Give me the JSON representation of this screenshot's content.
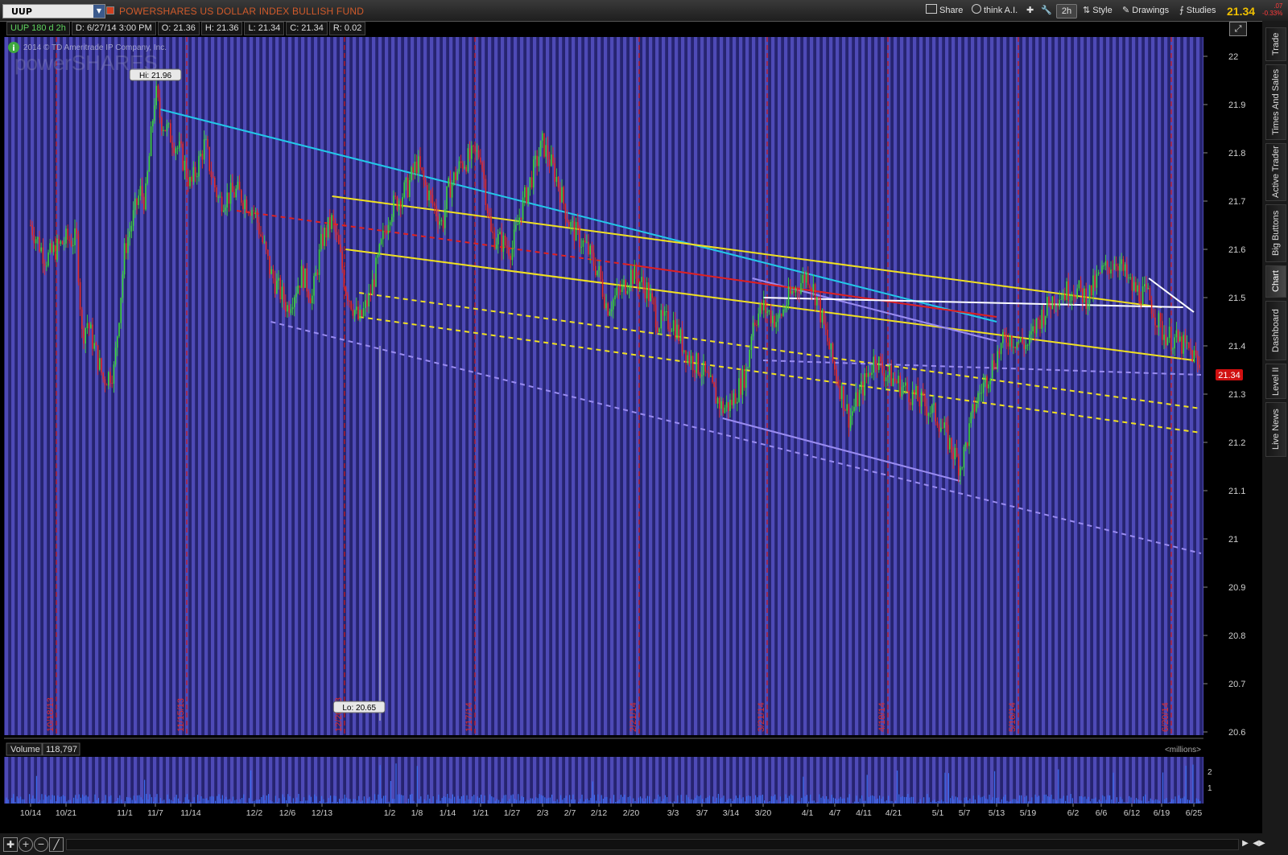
{
  "toolbar": {
    "symbol": "UUP",
    "fund_name": "POWERSHARES US DOLLAR INDEX BULLISH FUND",
    "share": "Share",
    "think": "think A.I.",
    "timeframe": "2h",
    "style": "Style",
    "drawings": "Drawings",
    "studies": "Studies",
    "last_price": "21.34",
    "net_change": ".07",
    "pct_change": "-0.33%"
  },
  "infobar": {
    "chart_spec": "UUP 180 d 2h",
    "date": "D: 6/27/14 3:00 PM",
    "open": "O: 21.36",
    "high": "H: 21.36",
    "low": "L: 21.34",
    "close": "C: 21.34",
    "range": "R: 0.02"
  },
  "watermark": {
    "copyright": "2014 © TD Ameritrade IP Company, Inc.",
    "brand": "powerSHARES"
  },
  "chart_data": {
    "type": "candlestick",
    "symbol": "UUP",
    "ylim": [
      20.6,
      22.05
    ],
    "y_ticks": [
      "22",
      "21.9",
      "21.8",
      "21.7",
      "21.6",
      "21.5",
      "21.4",
      "21.3",
      "21.2",
      "21.1",
      "21",
      "20.9",
      "20.8",
      "20.7",
      "20.6"
    ],
    "x_ticks": [
      "10/14",
      "10/21",
      "11/1",
      "11/7",
      "11/14",
      "12/2",
      "12/6",
      "12/13",
      "1/2",
      "1/8",
      "1/14",
      "1/21",
      "1/27",
      "2/3",
      "2/7",
      "2/12",
      "2/20",
      "3/3",
      "3/7",
      "3/14",
      "3/20",
      "4/1",
      "4/7",
      "4/11",
      "4/21",
      "5/1",
      "5/7",
      "5/13",
      "5/19",
      "6/2",
      "6/6",
      "6/12",
      "6/19",
      "6/25"
    ],
    "expiration_labels": [
      "10/18/13",
      "11/15/13",
      "12/20/13",
      "1/17/14",
      "2/21/14",
      "3/21/14",
      "4/18/14",
      "5/16/14",
      "6/20/14"
    ],
    "grid": false,
    "price_series": [
      {
        "x": "10/14",
        "y": 21.65
      },
      {
        "x": "10/17",
        "y": 21.58
      },
      {
        "x": "10/21",
        "y": 21.62
      },
      {
        "x": "10/23",
        "y": 21.62
      },
      {
        "x": "10/24",
        "y": 21.42
      },
      {
        "x": "10/25",
        "y": 21.45
      },
      {
        "x": "10/28",
        "y": 21.33
      },
      {
        "x": "10/30",
        "y": 21.35
      },
      {
        "x": "11/1",
        "y": 21.6
      },
      {
        "x": "11/4",
        "y": 21.72
      },
      {
        "x": "11/5",
        "y": 21.7
      },
      {
        "x": "11/7",
        "y": 21.93
      },
      {
        "x": "11/8",
        "y": 21.87
      },
      {
        "x": "11/12",
        "y": 21.8
      },
      {
        "x": "11/14",
        "y": 21.73
      },
      {
        "x": "11/18",
        "y": 21.82
      },
      {
        "x": "11/20",
        "y": 21.75
      },
      {
        "x": "11/22",
        "y": 21.7
      },
      {
        "x": "11/27",
        "y": 21.72
      },
      {
        "x": "12/2",
        "y": 21.68
      },
      {
        "x": "12/4",
        "y": 21.55
      },
      {
        "x": "12/6",
        "y": 21.48
      },
      {
        "x": "12/9",
        "y": 21.55
      },
      {
        "x": "12/11",
        "y": 21.5
      },
      {
        "x": "12/13",
        "y": 21.62
      },
      {
        "x": "12/16",
        "y": 21.66
      },
      {
        "x": "12/18",
        "y": 21.6
      },
      {
        "x": "12/20",
        "y": 21.52
      },
      {
        "x": "12/24",
        "y": 21.45
      },
      {
        "x": "12/27",
        "y": 21.5
      },
      {
        "x": "1/2",
        "y": 21.68
      },
      {
        "x": "1/6",
        "y": 21.73
      },
      {
        "x": "1/8",
        "y": 21.78
      },
      {
        "x": "1/10",
        "y": 21.72
      },
      {
        "x": "1/13",
        "y": 21.65
      },
      {
        "x": "1/14",
        "y": 21.72
      },
      {
        "x": "1/17",
        "y": 21.78
      },
      {
        "x": "1/21",
        "y": 21.8
      },
      {
        "x": "1/23",
        "y": 21.63
      },
      {
        "x": "1/27",
        "y": 21.6
      },
      {
        "x": "1/29",
        "y": 21.68
      },
      {
        "x": "2/3",
        "y": 21.82
      },
      {
        "x": "2/5",
        "y": 21.75
      },
      {
        "x": "2/7",
        "y": 21.65
      },
      {
        "x": "2/10",
        "y": 21.6
      },
      {
        "x": "2/12",
        "y": 21.55
      },
      {
        "x": "2/14",
        "y": 21.48
      },
      {
        "x": "2/18",
        "y": 21.52
      },
      {
        "x": "2/20",
        "y": 21.55
      },
      {
        "x": "2/24",
        "y": 21.52
      },
      {
        "x": "2/27",
        "y": 21.45
      },
      {
        "x": "3/3",
        "y": 21.45
      },
      {
        "x": "3/5",
        "y": 21.38
      },
      {
        "x": "3/7",
        "y": 21.35
      },
      {
        "x": "3/10",
        "y": 21.3
      },
      {
        "x": "3/12",
        "y": 21.27
      },
      {
        "x": "3/14",
        "y": 21.28
      },
      {
        "x": "3/17",
        "y": 21.35
      },
      {
        "x": "3/18",
        "y": 21.45
      },
      {
        "x": "3/20",
        "y": 21.48
      },
      {
        "x": "3/24",
        "y": 21.45
      },
      {
        "x": "3/27",
        "y": 21.5
      },
      {
        "x": "4/1",
        "y": 21.55
      },
      {
        "x": "4/3",
        "y": 21.5
      },
      {
        "x": "4/7",
        "y": 21.35
      },
      {
        "x": "4/9",
        "y": 21.25
      },
      {
        "x": "4/11",
        "y": 21.32
      },
      {
        "x": "4/15",
        "y": 21.38
      },
      {
        "x": "4/17",
        "y": 21.35
      },
      {
        "x": "4/21",
        "y": 21.33
      },
      {
        "x": "4/25",
        "y": 21.3
      },
      {
        "x": "4/29",
        "y": 21.27
      },
      {
        "x": "5/1",
        "y": 21.25
      },
      {
        "x": "5/6",
        "y": 21.15
      },
      {
        "x": "5/7",
        "y": 21.18
      },
      {
        "x": "5/9",
        "y": 21.28
      },
      {
        "x": "5/13",
        "y": 21.38
      },
      {
        "x": "5/15",
        "y": 21.42
      },
      {
        "x": "5/19",
        "y": 21.4
      },
      {
        "x": "5/22",
        "y": 21.45
      },
      {
        "x": "5/27",
        "y": 21.5
      },
      {
        "x": "6/2",
        "y": 21.52
      },
      {
        "x": "6/4",
        "y": 21.5
      },
      {
        "x": "6/6",
        "y": 21.55
      },
      {
        "x": "6/9",
        "y": 21.58
      },
      {
        "x": "6/12",
        "y": 21.52
      },
      {
        "x": "6/16",
        "y": 21.5
      },
      {
        "x": "6/19",
        "y": 21.43
      },
      {
        "x": "6/23",
        "y": 21.4
      },
      {
        "x": "6/25",
        "y": 21.38
      },
      {
        "x": "6/27",
        "y": 21.34
      }
    ],
    "annotations": [
      {
        "label": "Hi: 21.96",
        "x": "11/7",
        "y": 21.96
      },
      {
        "label": "Lo: 20.65",
        "x": "12/24",
        "y": 20.65
      }
    ],
    "current_price": "21.34",
    "trendlines": [
      {
        "color": "#22c8e8",
        "style": "solid",
        "from": {
          "x": "11/8",
          "y": 21.89
        },
        "to": {
          "x": "5/13",
          "y": 21.45
        }
      },
      {
        "color": "#f0e020",
        "style": "solid",
        "from": {
          "x": "12/16",
          "y": 21.71
        },
        "to": {
          "x": "6/19",
          "y": 21.48
        }
      },
      {
        "color": "#f0e020",
        "style": "solid",
        "from": {
          "x": "12/20",
          "y": 21.6
        },
        "to": {
          "x": "6/25",
          "y": 21.37
        }
      },
      {
        "color": "#f0e020",
        "style": "dashed",
        "from": {
          "x": "12/24",
          "y": 21.51
        },
        "to": {
          "x": "6/27",
          "y": 21.27
        }
      },
      {
        "color": "#f0e020",
        "style": "dashed",
        "from": {
          "x": "12/24",
          "y": 21.46
        },
        "to": {
          "x": "6/27",
          "y": 21.22
        }
      },
      {
        "color": "#9a8cf0",
        "style": "dashed",
        "from": {
          "x": "12/4",
          "y": 21.45
        },
        "to": {
          "x": "6/27",
          "y": 20.97
        }
      },
      {
        "color": "#9a8cf0",
        "style": "solid",
        "from": {
          "x": "3/12",
          "y": 21.25
        },
        "to": {
          "x": "5/6",
          "y": 21.12
        }
      },
      {
        "color": "#9a8cf0",
        "style": "dashed",
        "from": {
          "x": "3/20",
          "y": 21.37
        },
        "to": {
          "x": "6/27",
          "y": 21.34
        }
      },
      {
        "color": "#9a8cf0",
        "style": "solid",
        "from": {
          "x": "3/18",
          "y": 21.54
        },
        "to": {
          "x": "5/13",
          "y": 21.41
        }
      },
      {
        "color": "#e02020",
        "style": "solid",
        "from": {
          "x": "2/18",
          "y": 21.57
        },
        "to": {
          "x": "5/13",
          "y": 21.46
        }
      },
      {
        "color": "#e02020",
        "style": "dashed",
        "from": {
          "x": "11/27",
          "y": 21.68
        },
        "to": {
          "x": "2/18",
          "y": 21.57
        }
      },
      {
        "color": "#ffffff",
        "style": "solid",
        "from": {
          "x": "3/20",
          "y": 21.5
        },
        "to": {
          "x": "6/23",
          "y": 21.48
        }
      },
      {
        "color": "#ffffff",
        "style": "solid",
        "from": {
          "x": "6/16",
          "y": 21.54
        },
        "to": {
          "x": "6/25",
          "y": 21.47
        }
      }
    ]
  },
  "volume": {
    "label": "Volume",
    "value": "118,797",
    "units": "<millions>",
    "y_ticks": [
      "2",
      "1"
    ]
  },
  "side_tabs": [
    "Trade",
    "Times And Sales",
    "Active Trader",
    "Big Buttons",
    "Chart",
    "Dashboard",
    "Level II",
    "Live News"
  ]
}
